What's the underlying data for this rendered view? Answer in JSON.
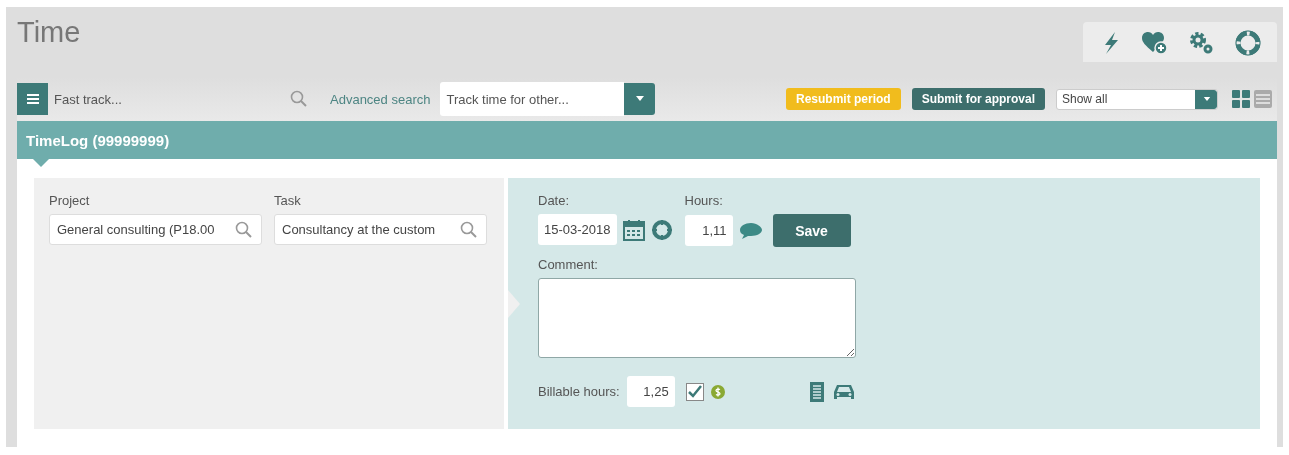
{
  "page": {
    "title": "Time"
  },
  "toolbar": {
    "fast_track": {
      "placeholder": "Fast track..."
    },
    "advanced_search": "Advanced search",
    "track_for_other": {
      "placeholder": "Track time for other..."
    },
    "resubmit": "Resubmit period",
    "submit": "Submit for approval",
    "filter": {
      "value": "Show all"
    },
    "view_modes": [
      {
        "kind": "grid",
        "selected": true
      },
      {
        "kind": "list",
        "selected": false
      }
    ]
  },
  "panel": {
    "title": "TimeLog (99999999)",
    "project": {
      "label": "Project",
      "value": "General consulting (P18.00"
    },
    "task": {
      "label": "Task",
      "value": "Consultancy at the custom"
    },
    "date": {
      "label": "Date:",
      "value": "15-03-2018"
    },
    "hours": {
      "label": "Hours:",
      "value": "1,11"
    },
    "save": "Save",
    "comment": {
      "label": "Comment:"
    },
    "billable": {
      "label": "Billable hours:",
      "value": "1,25",
      "checked": true
    }
  }
}
